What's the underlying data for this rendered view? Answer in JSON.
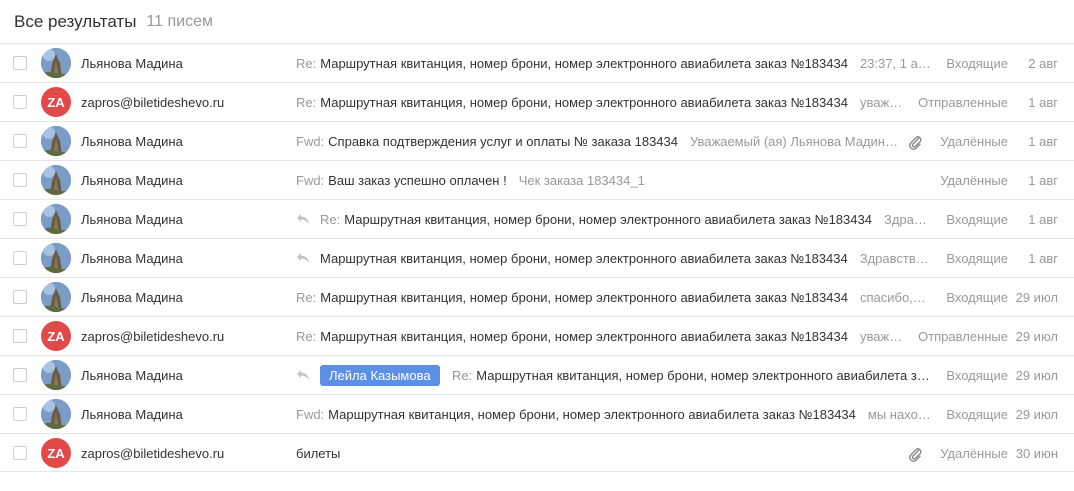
{
  "header": {
    "title": "Все результаты",
    "count": "11 писем"
  },
  "rows": [
    {
      "sender": "Льянова Мадина",
      "avatar": "photo",
      "prefix": "Re:",
      "subject": "Маршрутная квитанция, номер брони, номер электронного авиабилета заказ №183434",
      "snippet": "23:37, 1 а…",
      "folder": "Входящие",
      "date": "2 авг"
    },
    {
      "sender": "zapros@biletideshevo.ru",
      "avatar": "za",
      "avatar_text": "ZA",
      "prefix": "Re:",
      "subject": "Маршрутная квитанция, номер брони, номер электронного авиабилета заказ №183434",
      "snippet": "уваж…",
      "folder": "Отправленные",
      "date": "1 авг"
    },
    {
      "sender": "Льянова Мадина",
      "avatar": "photo",
      "prefix": "Fwd:",
      "subject": "Справка подтверждения услуг и оплаты № заказа 183434",
      "snippet": "Уважаемый (ая) Льянова Мадин…",
      "attachment": true,
      "folder": "Удалённые",
      "date": "1 авг"
    },
    {
      "sender": "Льянова Мадина",
      "avatar": "photo",
      "prefix": "Fwd:",
      "subject": "Ваш заказ успешно оплачен !",
      "snippet": "Чек заказа 183434_1",
      "folder": "Удалённые",
      "date": "1 авг"
    },
    {
      "sender": "Льянова Мадина",
      "avatar": "photo",
      "replied": true,
      "prefix": "Re:",
      "subject": "Маршрутная квитанция, номер брони, номер электронного авиабилета заказ №183434",
      "snippet": "Здра…",
      "folder": "Входящие",
      "date": "1 авг"
    },
    {
      "sender": "Льянова Мадина",
      "avatar": "photo",
      "replied": true,
      "prefix": "",
      "subject": "Маршрутная квитанция, номер брони, номер электронного авиабилета заказ №183434",
      "snippet": "Здравств…",
      "folder": "Входящие",
      "date": "1 авг"
    },
    {
      "sender": "Льянова Мадина",
      "avatar": "photo",
      "prefix": "Re:",
      "subject": "Маршрутная квитанция, номер брони, номер электронного авиабилета заказ №183434",
      "snippet": "спасибо,…",
      "folder": "Входящие",
      "date": "29 июл"
    },
    {
      "sender": "zapros@biletideshevo.ru",
      "avatar": "za",
      "avatar_text": "ZA",
      "prefix": "Re:",
      "subject": "Маршрутная квитанция, номер брони, номер электронного авиабилета заказ №183434",
      "snippet": "уваж…",
      "folder": "Отправленные",
      "date": "29 июл"
    },
    {
      "sender": "Льянова Мадина",
      "avatar": "photo",
      "replied": true,
      "tag": "Лейла Казымова",
      "prefix": "Re:",
      "subject": "Маршрутная квитанция, номер брони, номер электронного авиабилета з…",
      "snippet": "",
      "folder": "Входящие",
      "date": "29 июл"
    },
    {
      "sender": "Льянова Мадина",
      "avatar": "photo",
      "prefix": "Fwd:",
      "subject": "Маршрутная квитанция, номер брони, номер электронного авиабилета заказ №183434",
      "snippet": "мы нахо…",
      "folder": "Входящие",
      "date": "29 июл"
    },
    {
      "sender": "zapros@biletideshevo.ru",
      "avatar": "za",
      "avatar_text": "ZA",
      "prefix": "",
      "subject": "билеты",
      "snippet": "",
      "attachment": true,
      "folder": "Удалённые",
      "date": "30 июн"
    }
  ],
  "colors": {
    "za_avatar": "#e24a4a",
    "tag_bg": "#5c8fe6",
    "muted_text": "#999999",
    "divider": "#e6e6e6"
  },
  "icons": {
    "reply": "reply-arrow-icon",
    "attachment": "paperclip-icon",
    "checkbox": "checkbox"
  }
}
